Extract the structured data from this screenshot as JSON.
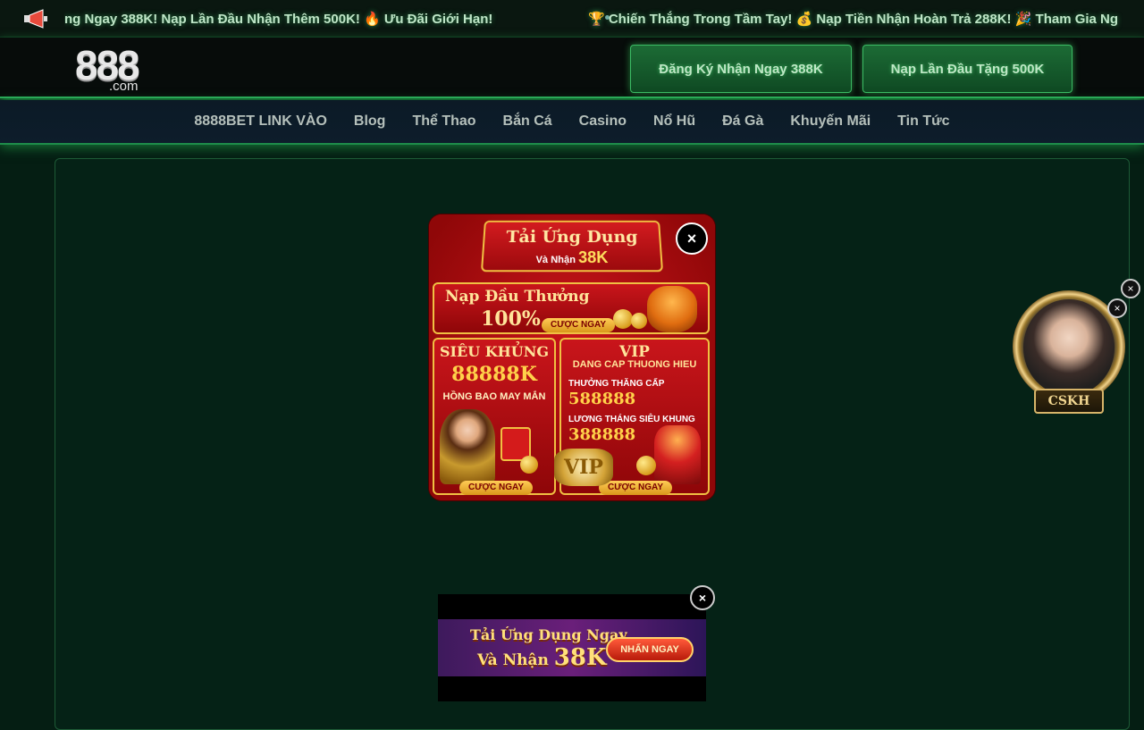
{
  "ticker": {
    "text": "ng Ngay 388K! Nạp Lần Đầu Nhận Thêm 500K! 🔥 Ưu Đãi Giới Hạn!",
    "text2": "🏆 Chiến Thắng Trong Tầm Tay! 💰 Nạp Tiền Nhận Hoàn Trả 288K! 🎉 Tham Gia Ng"
  },
  "header": {
    "logo_main": "888",
    "logo_sub": ".com",
    "btn_register": "Đăng Ký Nhận Ngay 388K",
    "btn_deposit": "Nạp Lần Đầu Tặng 500K"
  },
  "nav": {
    "items": [
      "8888BET LINK VÀO",
      "Blog",
      "Thể Thao",
      "Bắn Cá",
      "Casino",
      "Nổ Hũ",
      "Đá Gà",
      "Khuyến Mãi",
      "Tin Tức"
    ]
  },
  "popup": {
    "ribbon_title": "Tải Ứng Dụng",
    "ribbon_sub": "Và Nhận",
    "ribbon_amount": "38K",
    "first_deposit_title": "Nạp Đầu Thưởng",
    "first_deposit_pct": "100%",
    "first_deposit_cta": "CƯỢC NGAY",
    "left_title": "SIÊU KHỦNG",
    "left_amount": "88888K",
    "left_sub": "HỒNG BAO MAY MẮN",
    "left_cta": "CƯỢC NGAY",
    "right_title": "VIP",
    "right_sub": "DANG CAP THUONG HIEU",
    "right_l1": "THƯỞNG THĂNG CẤP",
    "right_v1": "588888",
    "right_l2": "LƯƠNG THÁNG SIÊU KHUNG",
    "right_v2": "388888",
    "right_cta": "CƯỢC NGAY",
    "vip_badge": "VIP",
    "close": "×"
  },
  "bottom_banner": {
    "line1": "Tải Ứng Dụng Ngay",
    "line2": "Và Nhận",
    "amount": "38K",
    "cta": "NHẤN NGAY",
    "close": "×"
  },
  "cskh": {
    "label": "CSKH",
    "close": "×"
  }
}
